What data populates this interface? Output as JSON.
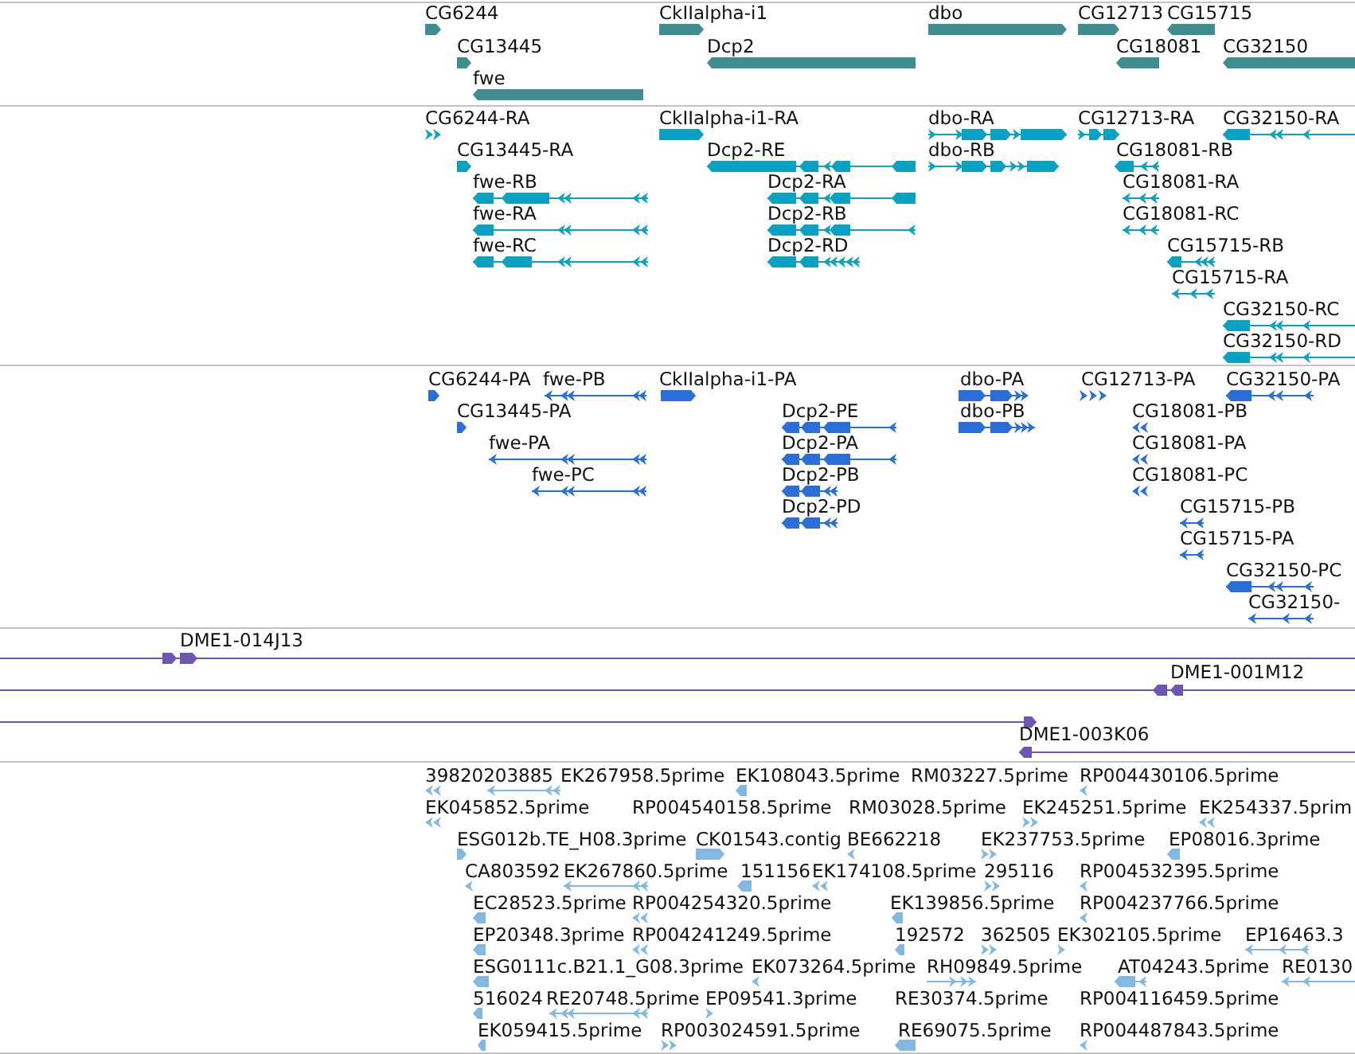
{
  "tracks": [
    {
      "color": "#3f8c91",
      "features": [
        {
          "label": "CG6244",
          "reverse": false
        },
        {
          "label": "CkIIalpha-i1",
          "reverse": false
        },
        {
          "label": "dbo",
          "reverse": false
        },
        {
          "label": "CG12713",
          "reverse": false
        },
        {
          "label": "CG15715",
          "reverse": true
        },
        {
          "label": "CG13445",
          "reverse": false
        },
        {
          "label": "Dcp2",
          "reverse": true
        },
        {
          "label": "CG18081",
          "reverse": true
        },
        {
          "label": "CG32150",
          "reverse": true
        },
        {
          "label": "fwe",
          "reverse": true
        }
      ]
    },
    {
      "color": "#0aa1c3",
      "features": [
        {
          "label": "CG6244-RA",
          "reverse": false
        },
        {
          "label": "CkIIalpha-i1-RA",
          "reverse": false
        },
        {
          "label": "dbo-RA",
          "reverse": false
        },
        {
          "label": "CG12713-RA",
          "reverse": false
        },
        {
          "label": "CG32150-RA",
          "reverse": true
        },
        {
          "label": "CG13445-RA",
          "reverse": false
        },
        {
          "label": "Dcp2-RE",
          "reverse": true
        },
        {
          "label": "dbo-RB",
          "reverse": false
        },
        {
          "label": "CG18081-RB",
          "reverse": true
        },
        {
          "label": "fwe-RB",
          "reverse": true
        },
        {
          "label": "Dcp2-RA",
          "reverse": true
        },
        {
          "label": "CG18081-RA",
          "reverse": true
        },
        {
          "label": "fwe-RA",
          "reverse": true
        },
        {
          "label": "Dcp2-RB",
          "reverse": true
        },
        {
          "label": "CG18081-RC",
          "reverse": true
        },
        {
          "label": "fwe-RC",
          "reverse": true
        },
        {
          "label": "Dcp2-RD",
          "reverse": true
        },
        {
          "label": "CG15715-RB",
          "reverse": true
        },
        {
          "label": "CG15715-RA",
          "reverse": true
        },
        {
          "label": "CG32150-RC",
          "reverse": true
        },
        {
          "label": "CG32150-RD",
          "reverse": true
        }
      ]
    },
    {
      "color": "#2a6fd8",
      "features": [
        {
          "label": "CG6244-PA",
          "reverse": false
        },
        {
          "label": "fwe-PB",
          "reverse": true
        },
        {
          "label": "CkIIalpha-i1-PA",
          "reverse": false
        },
        {
          "label": "dbo-PA",
          "reverse": false
        },
        {
          "label": "CG12713-PA",
          "reverse": false
        },
        {
          "label": "CG32150-PA",
          "reverse": true
        },
        {
          "label": "CG13445-PA",
          "reverse": false
        },
        {
          "label": "Dcp2-PE",
          "reverse": true
        },
        {
          "label": "dbo-PB",
          "reverse": false
        },
        {
          "label": "CG18081-PB",
          "reverse": true
        },
        {
          "label": "fwe-PA",
          "reverse": true
        },
        {
          "label": "Dcp2-PA",
          "reverse": true
        },
        {
          "label": "CG18081-PA",
          "reverse": true
        },
        {
          "label": "fwe-PC",
          "reverse": true
        },
        {
          "label": "Dcp2-PB",
          "reverse": true
        },
        {
          "label": "CG18081-PC",
          "reverse": true
        },
        {
          "label": "Dcp2-PD",
          "reverse": true
        },
        {
          "label": "CG15715-PB",
          "reverse": true
        },
        {
          "label": "CG15715-PA",
          "reverse": true
        },
        {
          "label": "CG32150-PC",
          "reverse": true
        },
        {
          "label": "CG32150-",
          "reverse": true
        }
      ]
    },
    {
      "color": "#7054b4",
      "features": [
        {
          "label": "DME1-014J13",
          "reverse": false
        },
        {
          "label": "DME1-001M12",
          "reverse": true
        },
        {
          "reverse": false
        },
        {
          "label": "DME1-003K06",
          "reverse": true
        }
      ]
    },
    {
      "color": "#82b9e2",
      "features": [
        {
          "label": "39820203885",
          "reverse": true
        },
        {
          "label": "EK267958.5prime",
          "reverse": true
        },
        {
          "label": "EK108043.5prime",
          "reverse": true
        },
        {
          "label": "RM03227.5prime"
        },
        {
          "label": "RP004430106.5prime",
          "reverse": true
        },
        {
          "label": "EK045852.5prime",
          "reverse": true
        },
        {
          "label": "RP004540158.5prime"
        },
        {
          "label": "RM03028.5prime"
        },
        {
          "label": "EK245251.5prime",
          "reverse": false
        },
        {
          "label": "EK254337.5prim",
          "reverse": true
        },
        {
          "label": "ESG012b.TE_H08.3prime",
          "reverse": false
        },
        {
          "label": "CK01543.contig",
          "reverse": false
        },
        {
          "label": "BE662218",
          "reverse": true
        },
        {
          "label": "EK237753.5prime",
          "reverse": false
        },
        {
          "label": "EP08016.3prime",
          "reverse": true
        },
        {
          "label": "CA803592",
          "reverse": true
        },
        {
          "label": "EK267860.5prime",
          "reverse": true
        },
        {
          "label": "151156",
          "reverse": true
        },
        {
          "label": "EK174108.5prime",
          "reverse": true
        },
        {
          "label": "295116",
          "reverse": false
        },
        {
          "label": "RP004532395.5prime",
          "reverse": true
        },
        {
          "label": "EC28523.5prime",
          "reverse": true
        },
        {
          "label": "RP004254320.5prime",
          "reverse": true
        },
        {
          "label": "EK139856.5prime",
          "reverse": true
        },
        {
          "label": "RP004237766.5prime",
          "reverse": true
        },
        {
          "label": "EP20348.3prime",
          "reverse": true
        },
        {
          "label": "RP004241249.5prime",
          "reverse": true
        },
        {
          "label": "192572",
          "reverse": true
        },
        {
          "label": "362505",
          "reverse": false
        },
        {
          "label": "EK302105.5prime",
          "reverse": false
        },
        {
          "label": "EP16463.3",
          "reverse": true
        },
        {
          "label": "ESG0111c.B21.1_G08.3prime",
          "reverse": true
        },
        {
          "label": "EK073264.5prime",
          "reverse": true
        },
        {
          "label": "RH09849.5prime",
          "reverse": false
        },
        {
          "label": "AT04243.5prime",
          "reverse": true
        },
        {
          "label": "RE0130",
          "reverse": true
        },
        {
          "label": "516024",
          "reverse": true
        },
        {
          "label": "RE20748.5prime",
          "reverse": true
        },
        {
          "label": "EP09541.3prime",
          "reverse": false
        },
        {
          "label": "RE30374.5prime"
        },
        {
          "label": "RP004116459.5prime"
        },
        {
          "label": "EK059415.5prime",
          "reverse": true
        },
        {
          "label": "RP003024591.5prime",
          "reverse": false
        },
        {
          "label": "RE69075.5prime",
          "reverse": true
        },
        {
          "label": "RP004487843.5prime",
          "reverse": true
        }
      ]
    }
  ]
}
